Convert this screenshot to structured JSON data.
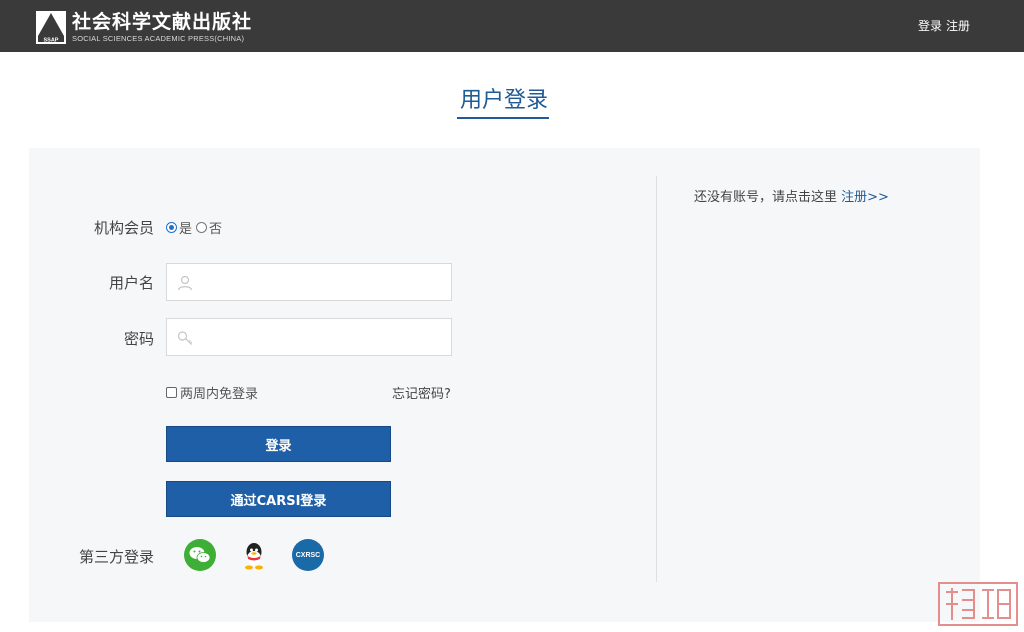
{
  "header": {
    "logo_cn": "社会科学文献出版社",
    "logo_en": "SOCIAL SCIENCES ACADEMIC PRESS(CHINA)",
    "logo_mark_text": "SSAP",
    "login_link": "登录",
    "register_link": "注册"
  },
  "page_title": "用户登录",
  "form": {
    "member_label": "机构会员",
    "member_options": [
      {
        "label": "是",
        "checked": true
      },
      {
        "label": "否",
        "checked": false
      }
    ],
    "username_label": "用户名",
    "username_value": "",
    "password_label": "密码",
    "password_value": "",
    "remember_label": "两周内免登录",
    "forgot_label": "忘记密码?",
    "login_button": "登录",
    "carsi_button": "通过CARSI登录",
    "third_party_label": "第三方登录",
    "third_party": [
      {
        "icon": "wechat-icon"
      },
      {
        "icon": "qq-icon"
      },
      {
        "icon": "cxrsc-icon",
        "text": "CXRSC"
      }
    ]
  },
  "side": {
    "no_account_text": "还没有账号，请点击这里",
    "register_link": "注册>>"
  },
  "colors": {
    "header_bg": "#3a3a3a",
    "accent": "#1f5b95",
    "button": "#1f5fa8"
  }
}
